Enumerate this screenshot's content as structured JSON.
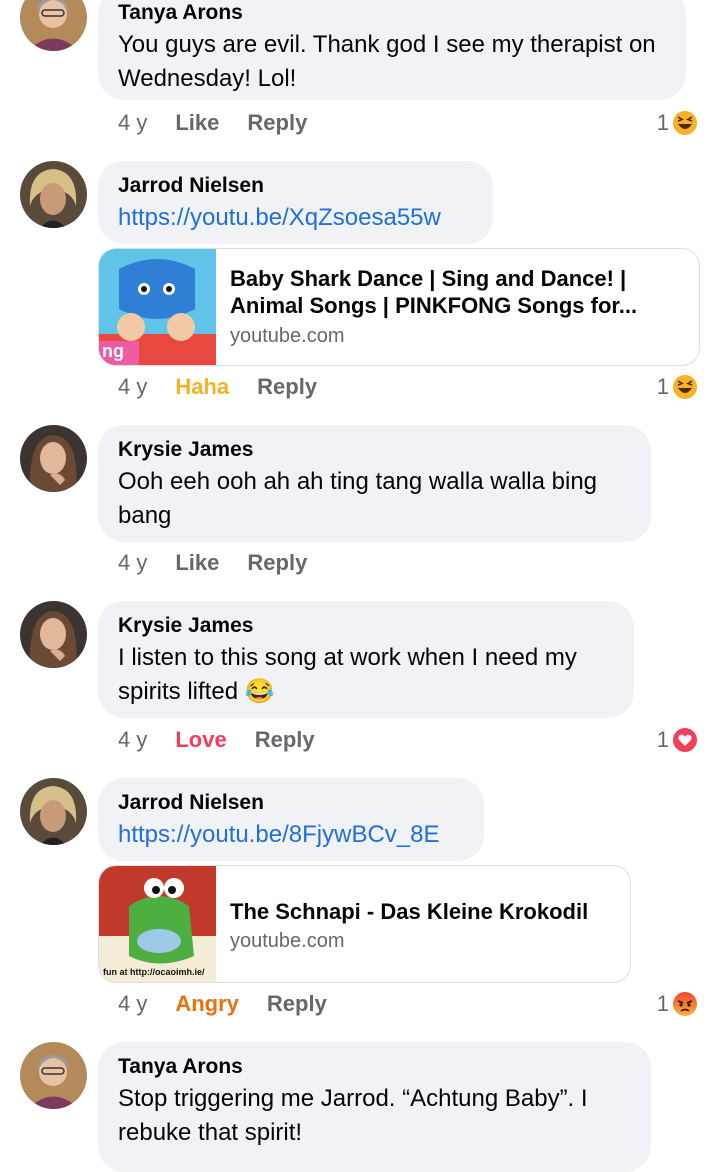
{
  "comments": [
    {
      "name": "Tanya Arons",
      "text": "You guys are evil.  Thank god I see my therapist on Wednesday! Lol!",
      "age": "4 y",
      "action": "Like",
      "reply": "Reply",
      "reaction_count": "1",
      "reaction_icon": "laugh-emoji",
      "reaction_color": "#f7b125"
    },
    {
      "name": "Jarrod Nielsen",
      "text": "https://youtu.be/XqZsoesa55w",
      "age": "4 y",
      "action": "Haha",
      "reply": "Reply",
      "reaction_count": "1",
      "reaction_icon": "laugh-emoji",
      "action_color": "#f7b125",
      "card": {
        "title": "Baby Shark Dance | Sing and Dance! | Animal Songs | PINKFONG Songs for...",
        "domain": "youtube.com",
        "thumb_text": "ng"
      }
    },
    {
      "name": "Krysie James",
      "text": "Ooh eeh ooh ah ah ting tang walla walla bing bang",
      "age": "4 y",
      "action": "Like",
      "reply": "Reply"
    },
    {
      "name": "Krysie James",
      "text": "I listen to this song at work when I need my spirits lifted 😂",
      "age": "4 y",
      "action": "Love",
      "reply": "Reply",
      "reaction_count": "1",
      "reaction_icon": "heart-icon",
      "action_color": "#f33e58"
    },
    {
      "name": "Jarrod Nielsen",
      "text": "https://youtu.be/8FjywBCv_8E",
      "age": "4 y",
      "action": "Angry",
      "reply": "Reply",
      "reaction_count": "1",
      "reaction_icon": "angry-emoji",
      "action_color": "#e9710f",
      "card": {
        "title": "The Schnapi - Das Kleine Krokodil",
        "domain": "youtube.com",
        "thumb_text": "fun at http://ocaoimh.ie/"
      }
    },
    {
      "name": "Tanya Arons",
      "text": "Stop triggering me Jarrod.  “Achtung Baby”. I rebuke that spirit!"
    }
  ]
}
